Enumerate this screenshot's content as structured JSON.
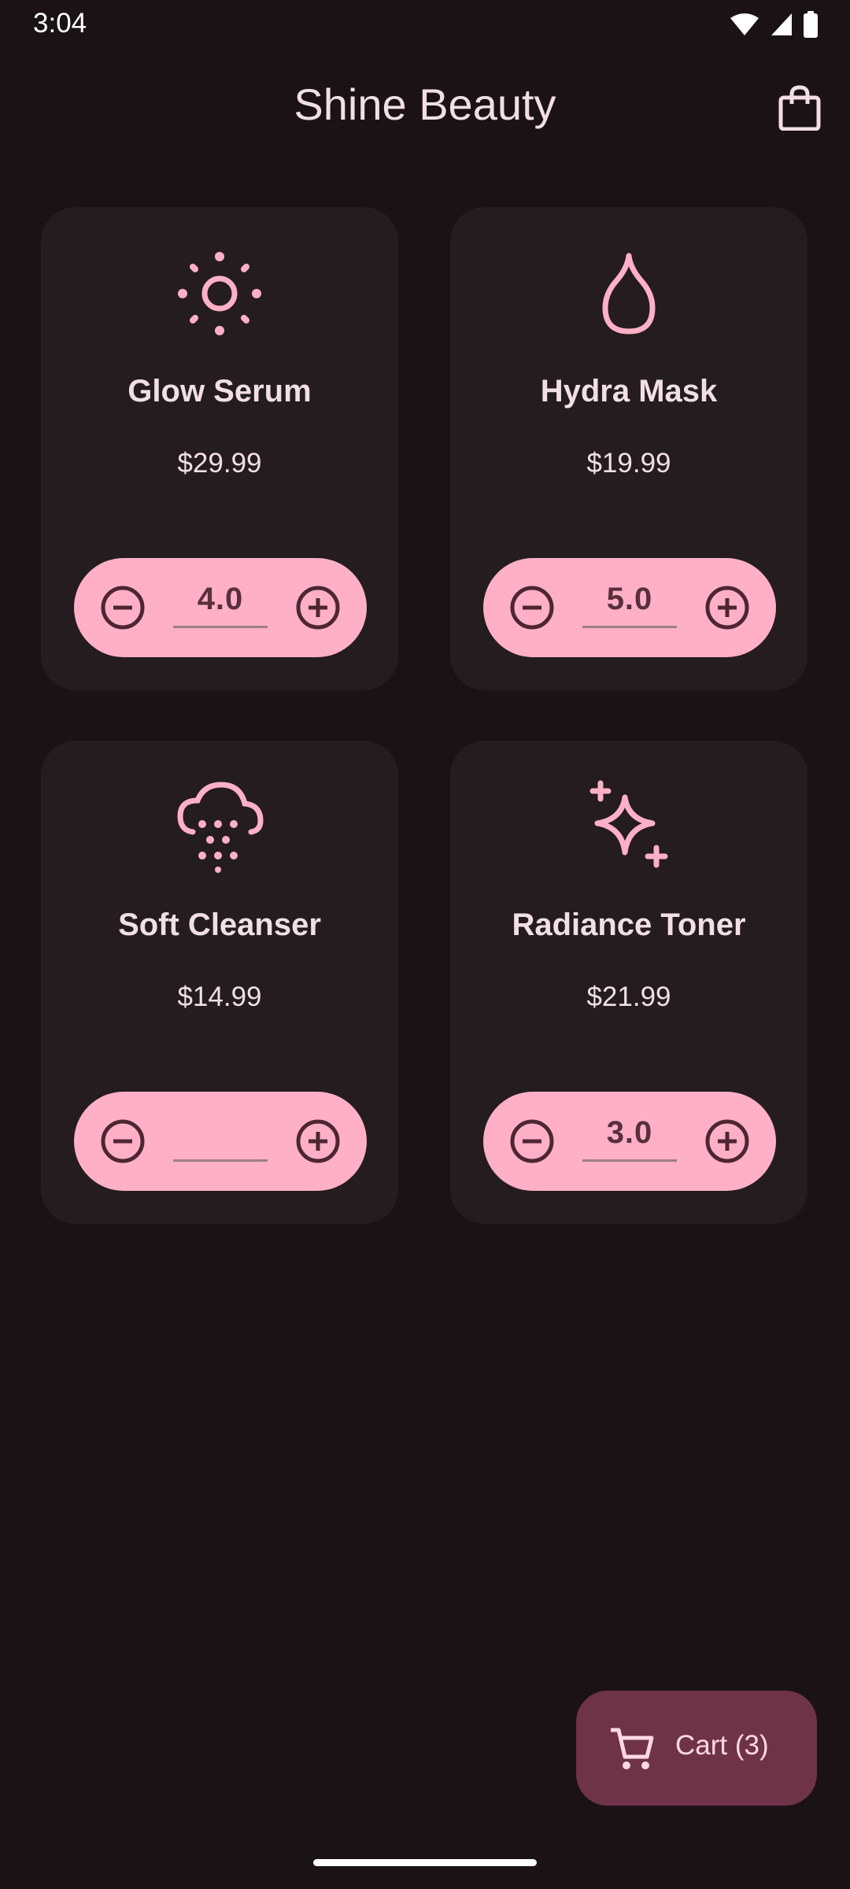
{
  "status_bar": {
    "time": "3:04"
  },
  "header": {
    "title": "Shine Beauty",
    "bag_icon": "shopping-bag-icon"
  },
  "colors": {
    "background": "#1b1216",
    "card": "#241c1f",
    "accent": "#ffb0c6",
    "fab": "#6f3348"
  },
  "products": [
    {
      "name": "Glow Serum",
      "price": "$29.99",
      "icon": "sun-icon",
      "quantity": "4.0"
    },
    {
      "name": "Hydra Mask",
      "price": "$19.99",
      "icon": "water-drop-icon",
      "quantity": "5.0"
    },
    {
      "name": "Soft Cleanser",
      "price": "$14.99",
      "icon": "rain-cloud-icon",
      "quantity": ""
    },
    {
      "name": "Radiance Toner",
      "price": "$21.99",
      "icon": "sparkle-icon",
      "quantity": "3.0"
    }
  ],
  "cart_button": {
    "label": "Cart (3)",
    "icon": "shopping-cart-icon"
  }
}
